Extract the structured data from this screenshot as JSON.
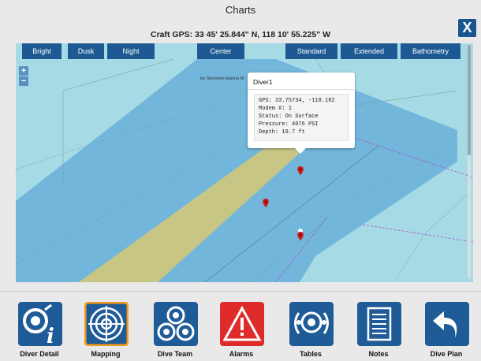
{
  "window": {
    "title": "Charts",
    "close_label": "X"
  },
  "gps_readout": "Craft GPS: 33 45' 25.844\" N, 118 10' 55.225\" W",
  "toolbar": {
    "bright": "Bright",
    "dusk": "Dusk",
    "night": "Night",
    "center": "Center",
    "standard": "Standard",
    "extended": "Extended",
    "bathometry": "Bathometry"
  },
  "zoom": {
    "in": "+",
    "out": "−"
  },
  "map": {
    "marina_label": "bn Shoreline Marina Bi"
  },
  "popup": {
    "title": "Diver1",
    "lines": [
      "GPS: 33.75734, -118.182",
      "Modem #: 1",
      "Status: On Surface",
      "Pressure: 4076 PSI",
      "Depth: 19.7 ft"
    ]
  },
  "nav": {
    "diver_detail": "Diver Detail",
    "mapping": "Mapping",
    "dive_team": "Dive Team",
    "alarms": "Alarms",
    "tables": "Tables",
    "notes": "Notes",
    "dive_plan": "Dive Plan"
  },
  "colors": {
    "button_blue": "#1d5a93",
    "water_light": "#a6dbe6",
    "water_deep": "#70b7da",
    "sand": "#c8c684",
    "alarm_red": "#e02b2b",
    "active_outline": "#f39a1c"
  }
}
